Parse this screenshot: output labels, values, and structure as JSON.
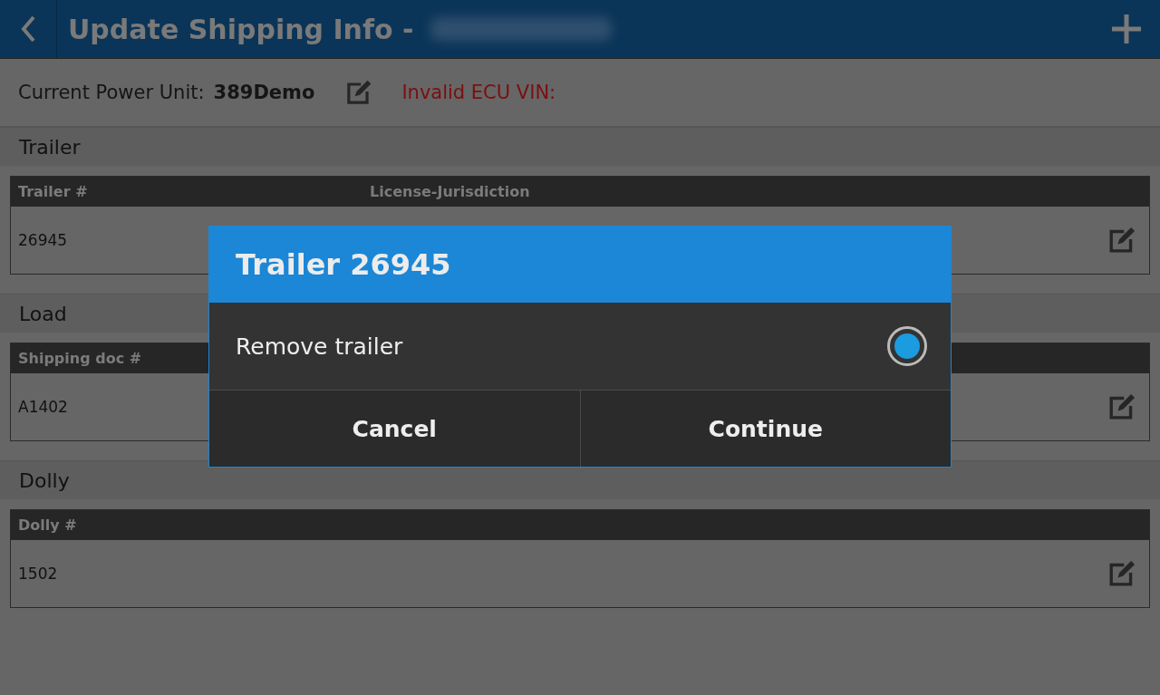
{
  "header": {
    "title": "Update Shipping Info -"
  },
  "power_unit": {
    "label": "Current Power Unit:",
    "value": "389Demo",
    "warning": "Invalid ECU VIN:"
  },
  "sections": [
    {
      "title": "Trailer",
      "columns": [
        "Trailer #",
        "License-Jurisdiction"
      ],
      "rows": [
        [
          "26945",
          ""
        ]
      ]
    },
    {
      "title": "Load",
      "columns": [
        "Shipping doc #"
      ],
      "rows": [
        [
          "A1402"
        ]
      ]
    },
    {
      "title": "Dolly",
      "columns": [
        "Dolly #"
      ],
      "rows": [
        [
          "1502"
        ]
      ]
    }
  ],
  "dialog": {
    "title": "Trailer 26945",
    "options": [
      {
        "label": "Remove trailer",
        "selected": true
      }
    ],
    "buttons": [
      "Cancel",
      "Continue"
    ]
  }
}
